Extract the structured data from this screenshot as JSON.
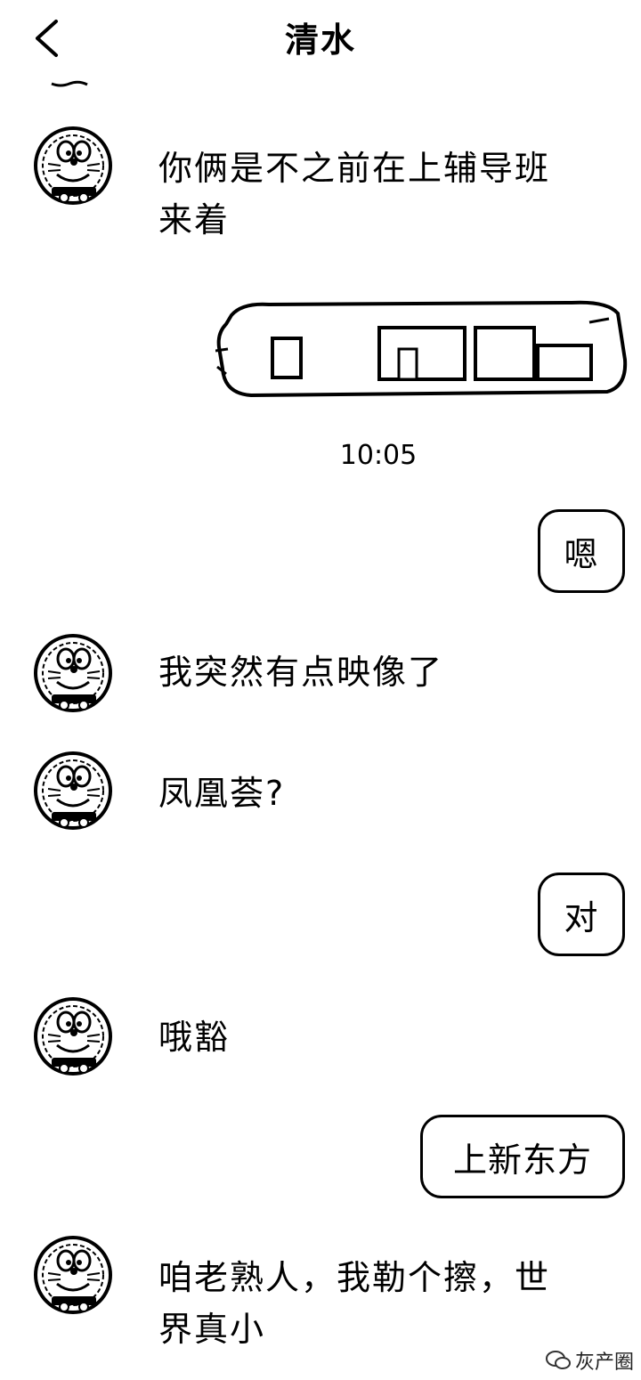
{
  "header": {
    "title": "清水"
  },
  "timestamp": "10:05",
  "messages": [
    {
      "side": "left",
      "text": "你俩是不之前在上辅导班\n来着"
    },
    {
      "side": "right",
      "text": "嗯"
    },
    {
      "side": "left",
      "text": "我突然有点映像了"
    },
    {
      "side": "left",
      "text": "凤凰荟?"
    },
    {
      "side": "right",
      "text": "对"
    },
    {
      "side": "left",
      "text": "哦豁"
    },
    {
      "side": "right",
      "text": "上新东方"
    },
    {
      "side": "left",
      "text": "咱老熟人，我勒个擦，世\n界真小"
    }
  ],
  "watermark": {
    "text": "灰产圈"
  },
  "icons": {
    "back": "chevron-left-icon",
    "avatar": "doraemon-avatar-icon",
    "sticker": "hand-drawn-sticker"
  }
}
